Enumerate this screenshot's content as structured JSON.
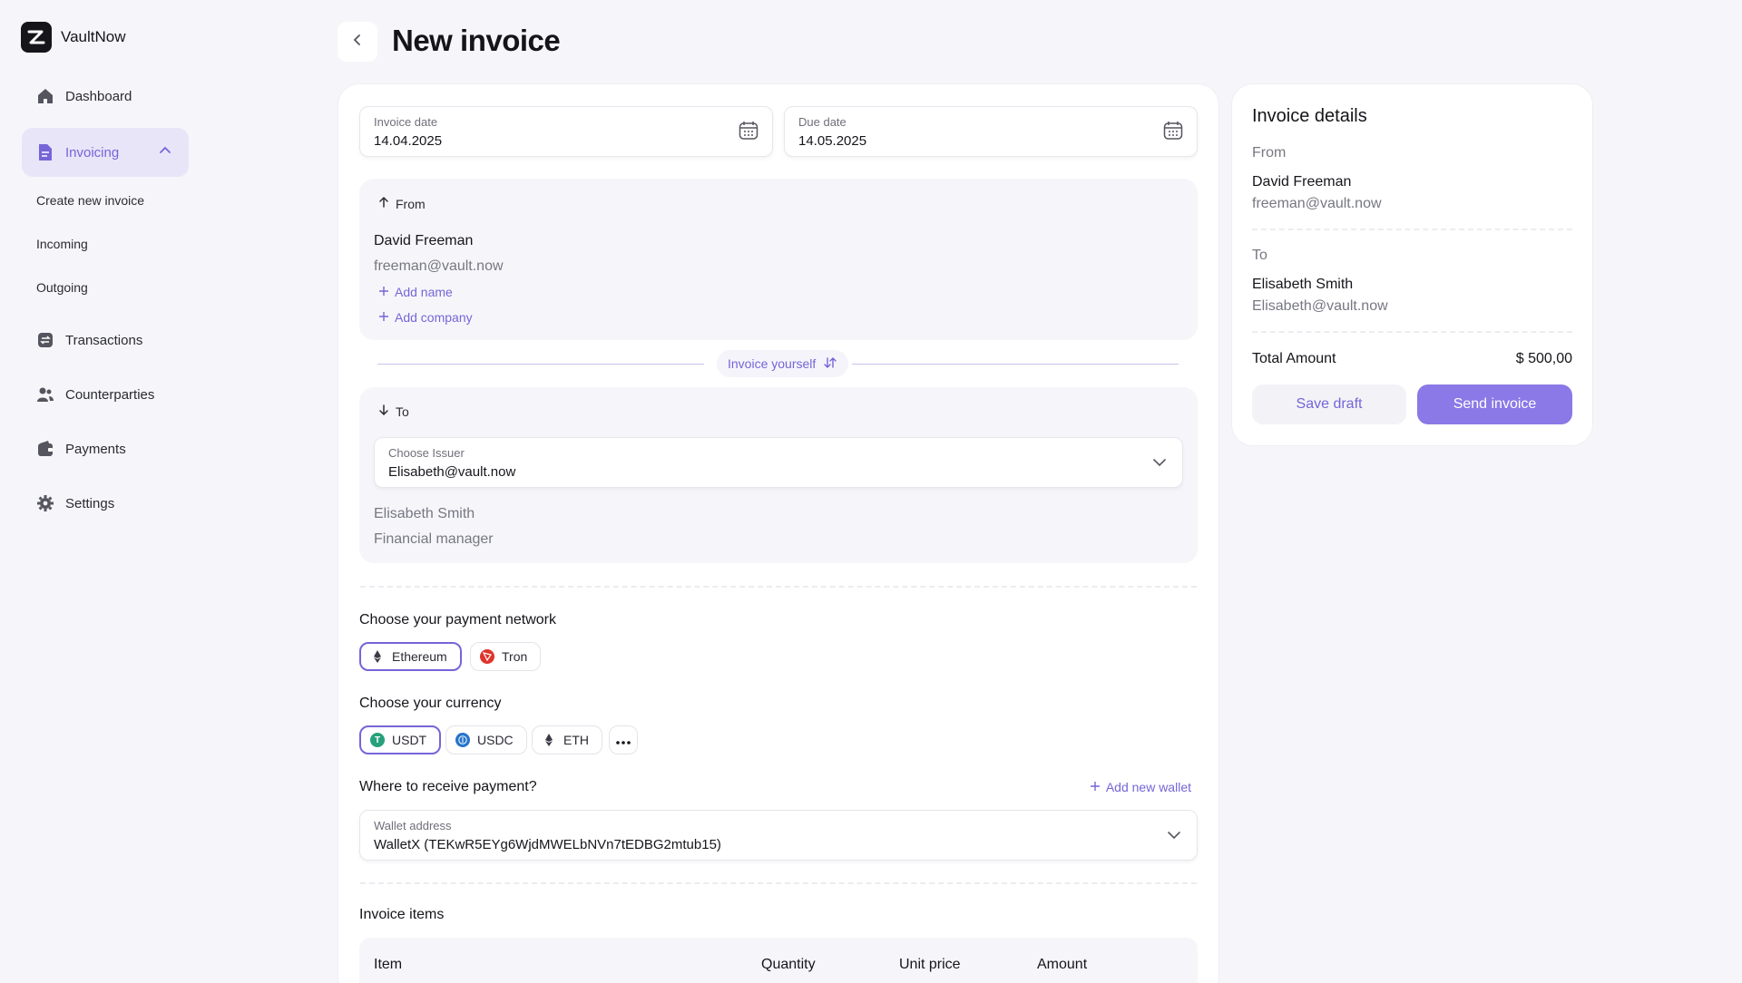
{
  "app": {
    "name": "VaultNow"
  },
  "sidebar": {
    "items": [
      {
        "label": "Dashboard"
      },
      {
        "label": "Invoicing"
      },
      {
        "label": "Transactions"
      },
      {
        "label": "Counterparties"
      },
      {
        "label": "Payments"
      },
      {
        "label": "Settings"
      }
    ],
    "sub_items": [
      {
        "label": "Create new invoice"
      },
      {
        "label": "Incoming"
      },
      {
        "label": "Outgoing"
      }
    ]
  },
  "header": {
    "title": "New invoice"
  },
  "form": {
    "invoice_date": {
      "label": "Invoice date",
      "value": "14.04.2025"
    },
    "due_date": {
      "label": "Due date",
      "value": "14.05.2025"
    },
    "from": {
      "header": "From",
      "name": "David Freeman",
      "email": "freeman@vault.now",
      "add_name": "Add name",
      "add_company": "Add company"
    },
    "swap_label": "Invoice yourself",
    "to": {
      "header": "To",
      "issuer_label": "Choose Issuer",
      "issuer_value": "Elisabeth@vault.now",
      "name": "Elisabeth Smith",
      "role": "Financial manager"
    },
    "network": {
      "title": "Choose your payment network",
      "options": [
        {
          "label": "Ethereum",
          "selected": true
        },
        {
          "label": "Tron",
          "selected": false
        }
      ]
    },
    "currency": {
      "title": "Choose your currency",
      "options": [
        {
          "label": "USDT",
          "selected": true
        },
        {
          "label": "USDC",
          "selected": false
        },
        {
          "label": "ETH",
          "selected": false
        }
      ]
    },
    "receive": {
      "title": "Where to receive payment?",
      "add_wallet": "Add new wallet",
      "wallet_label": "Wallet address",
      "wallet_value": "WalletX (TEKwR5EYg6WjdMWELbNVn7tEDBG2mtub15)"
    },
    "items": {
      "title": "Invoice items",
      "columns": [
        "Item",
        "Quantity",
        "Unit price",
        "Amount"
      ]
    }
  },
  "details": {
    "title": "Invoice details",
    "from_label": "From",
    "from_name": "David Freeman",
    "from_email": "freeman@vault.now",
    "to_label": "To",
    "to_name": "Elisabeth Smith",
    "to_email": "Elisabeth@vault.now",
    "total_label": "Total Amount",
    "total_value": "$ 500,00",
    "save_draft": "Save draft",
    "send_invoice": "Send invoice"
  },
  "colors": {
    "accent": "#7565d8",
    "accent_button": "#8a79e6",
    "background": "#f6f6fa"
  }
}
